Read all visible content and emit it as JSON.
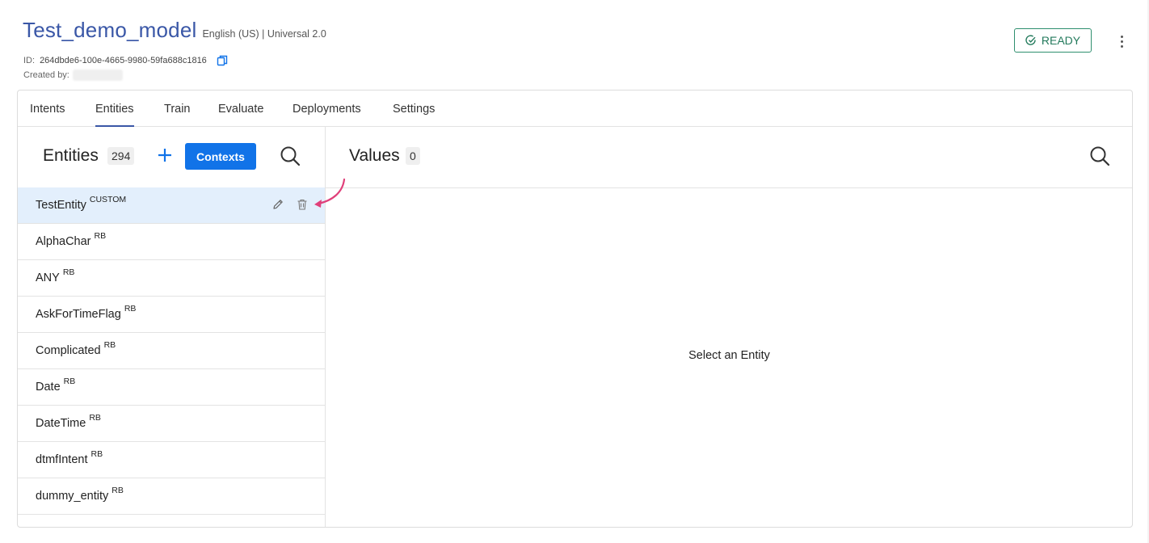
{
  "model": {
    "title": "Test_demo_model",
    "subtitle": "English (US) | Universal 2.0",
    "id_label": "ID:",
    "id_value": "264dbde6-100e-4665-9980-59fa688c1816",
    "created_label": "Created by:"
  },
  "status": {
    "label": "READY",
    "color": "#237a5c"
  },
  "tabs": [
    {
      "label": "Intents"
    },
    {
      "label": "Entities",
      "active": true
    },
    {
      "label": "Train"
    },
    {
      "label": "Evaluate"
    },
    {
      "label": "Deployments"
    },
    {
      "label": "Settings"
    }
  ],
  "entities_panel": {
    "title": "Entities",
    "count": "294",
    "contexts_label": "Contexts",
    "items": [
      {
        "name": "TestEntity",
        "tag": "CUSTOM"
      },
      {
        "name": "AlphaChar",
        "tag": "RB"
      },
      {
        "name": "ANY",
        "tag": "RB"
      },
      {
        "name": "AskForTimeFlag",
        "tag": "RB"
      },
      {
        "name": "Complicated",
        "tag": "RB"
      },
      {
        "name": "Date",
        "tag": "RB"
      },
      {
        "name": "DateTime",
        "tag": "RB"
      },
      {
        "name": "dtmfIntent",
        "tag": "RB"
      },
      {
        "name": "dummy_entity",
        "tag": "RB"
      }
    ]
  },
  "values_panel": {
    "title": "Values",
    "count": "0",
    "empty_message": "Select an Entity"
  },
  "colors": {
    "accent": "#3a57a7",
    "primary_button": "#1173e8",
    "selected_row": "#e3effc",
    "annotation_arrow": "#e0407a"
  },
  "icons": [
    "copy-icon",
    "check-circle-icon",
    "more-vertical-icon",
    "plus-icon",
    "search-icon",
    "pencil-icon",
    "trash-icon",
    "arrow-annotation"
  ]
}
